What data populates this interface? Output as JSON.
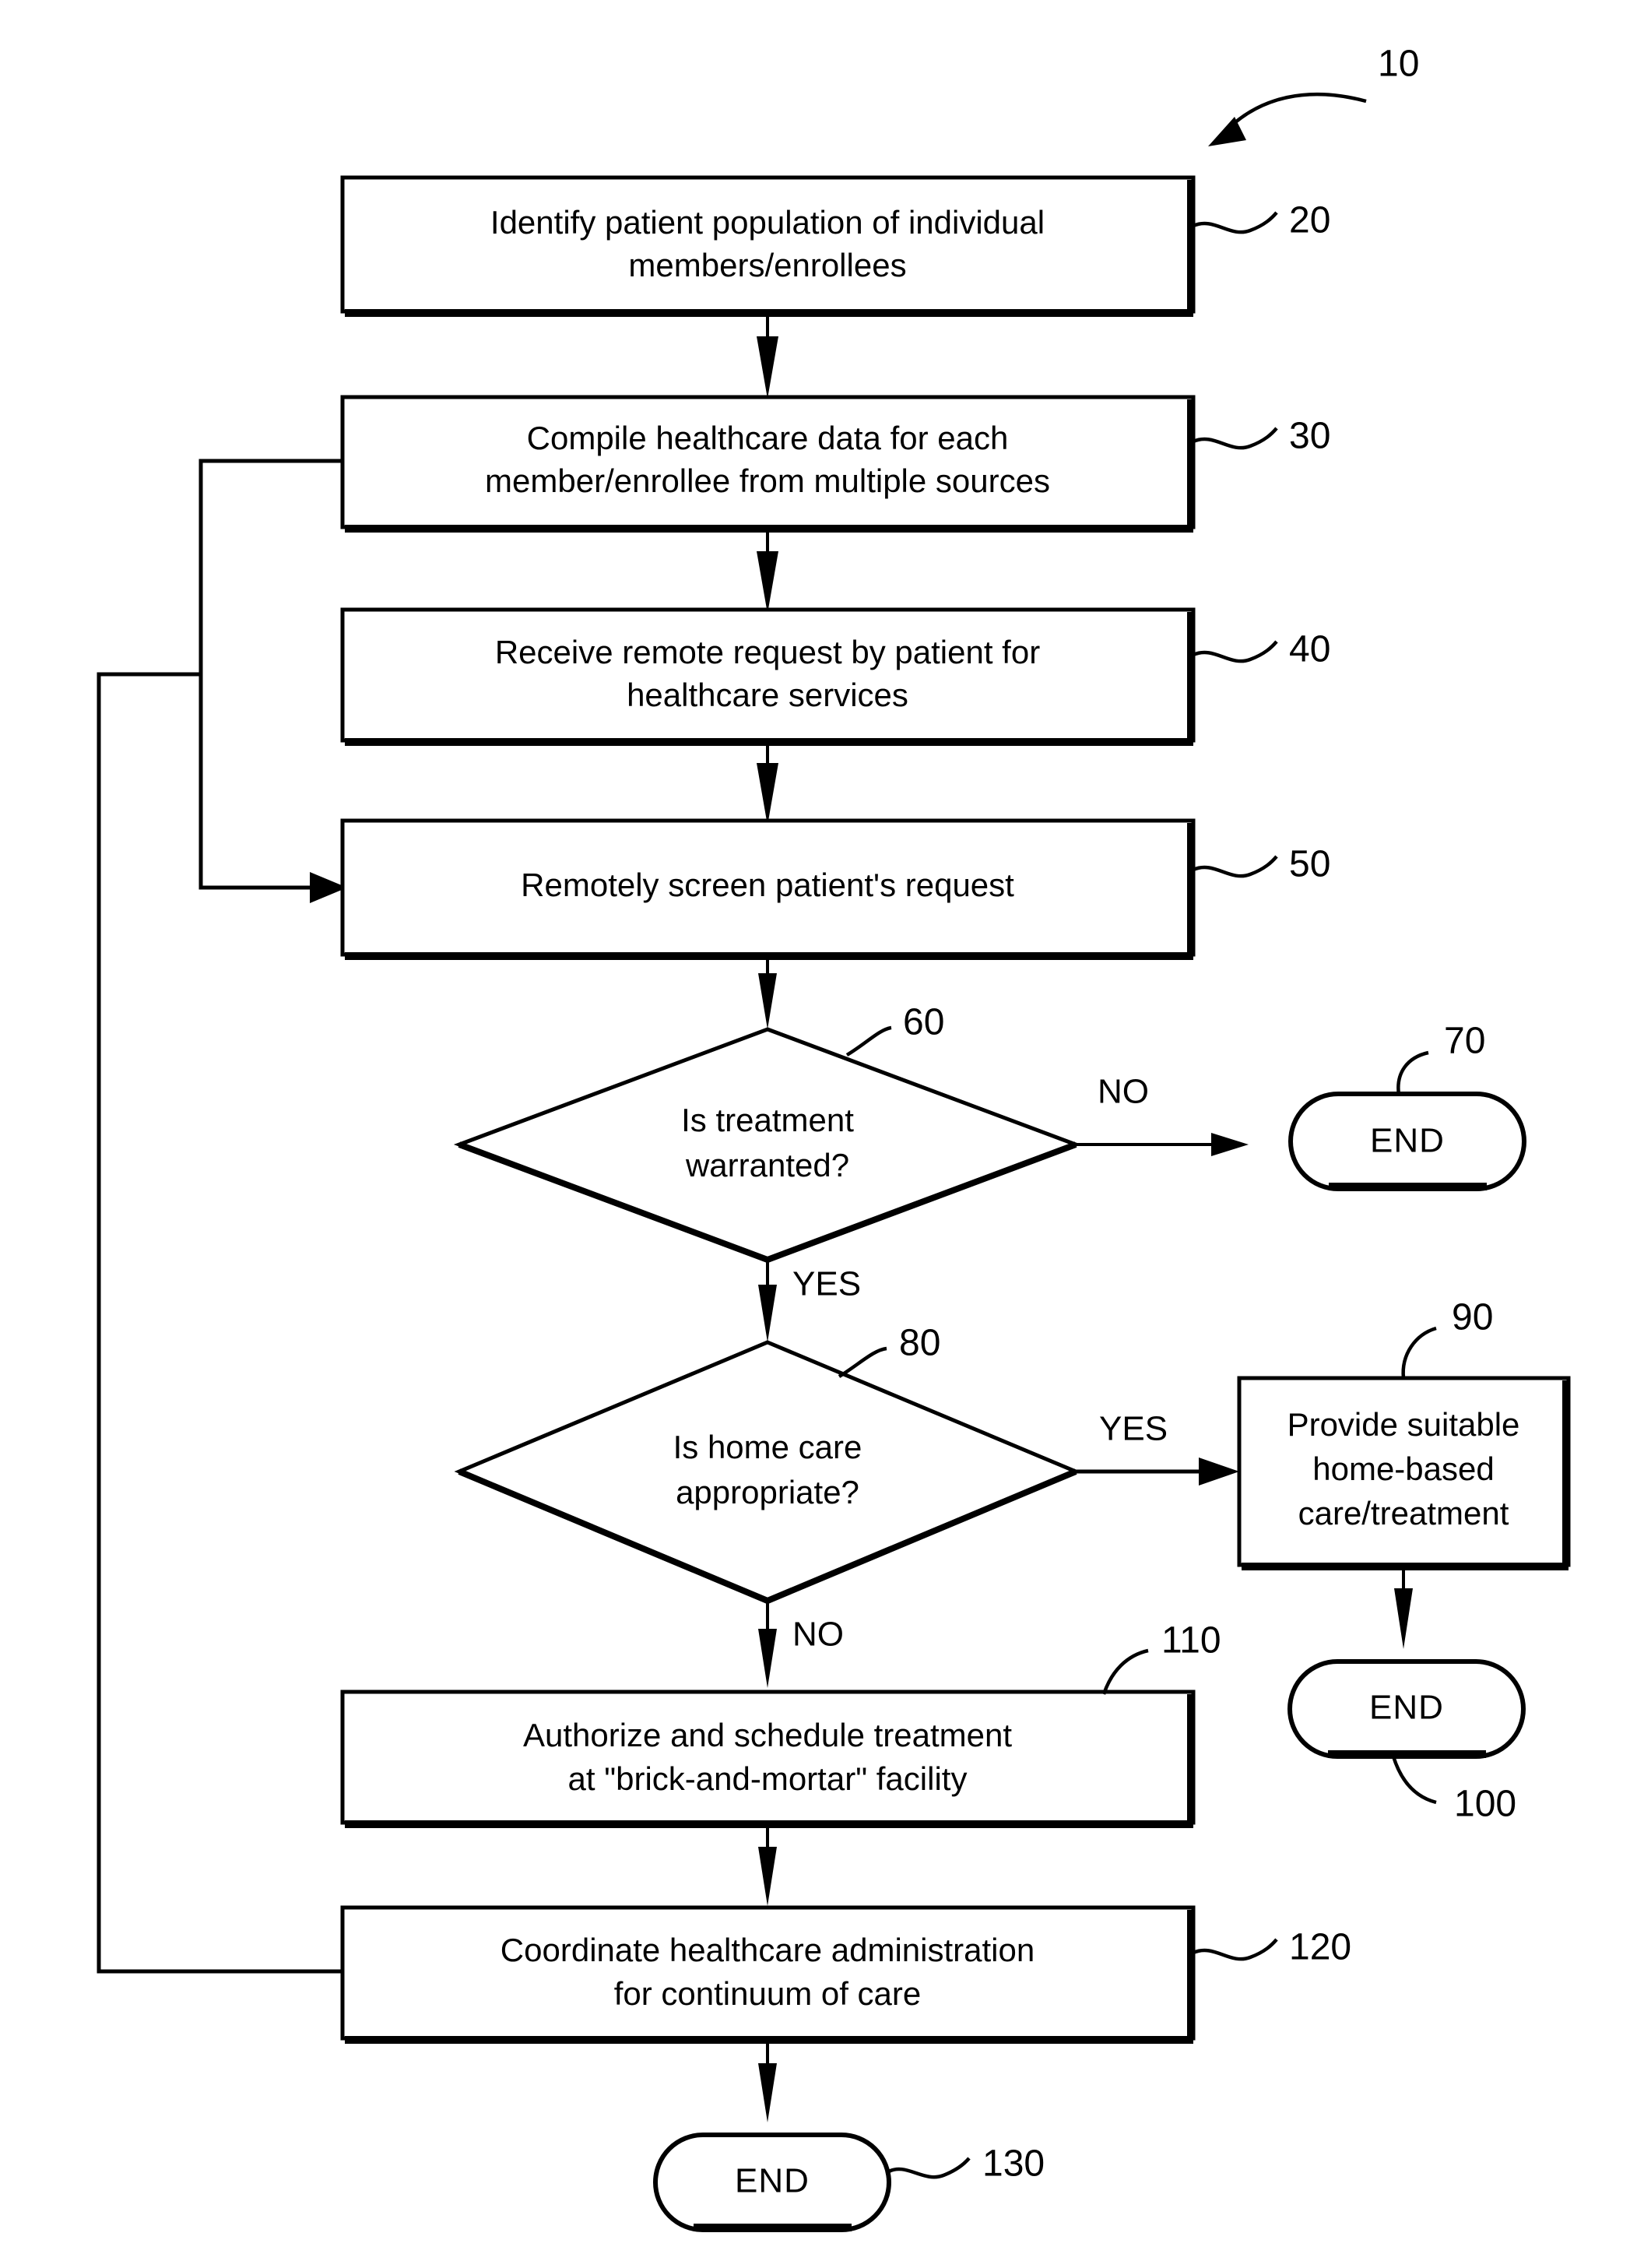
{
  "figure": {
    "label": "10",
    "type": "patent-flowchart",
    "background_color": "#ffffff",
    "line_color": "#000000"
  },
  "nodes": [
    {
      "id": "n20",
      "ref": "20",
      "shape": "process",
      "lines": [
        "Identify patient population of individual",
        "members/enrollees"
      ]
    },
    {
      "id": "n30",
      "ref": "30",
      "shape": "process",
      "lines": [
        "Compile healthcare data for each",
        "member/enrollee from multiple sources"
      ]
    },
    {
      "id": "n40",
      "ref": "40",
      "shape": "process",
      "lines": [
        "Receive remote request by patient for",
        "healthcare services"
      ]
    },
    {
      "id": "n50",
      "ref": "50",
      "shape": "process",
      "lines": [
        "Remotely screen patient's request"
      ]
    },
    {
      "id": "n60",
      "ref": "60",
      "shape": "decision",
      "lines": [
        "Is treatment",
        "warranted?"
      ]
    },
    {
      "id": "n70",
      "ref": "70",
      "shape": "terminator",
      "lines": [
        "END"
      ]
    },
    {
      "id": "n80",
      "ref": "80",
      "shape": "decision",
      "lines": [
        "Is home care",
        "appropriate?"
      ]
    },
    {
      "id": "n90",
      "ref": "90",
      "shape": "process",
      "lines": [
        "Provide suitable",
        "home-based",
        "care/treatment"
      ]
    },
    {
      "id": "n100",
      "ref": "100",
      "shape": "terminator",
      "lines": [
        "END"
      ]
    },
    {
      "id": "n110",
      "ref": "110",
      "shape": "process",
      "lines": [
        "Authorize and schedule treatment",
        "at \"brick-and-mortar\" facility"
      ]
    },
    {
      "id": "n120",
      "ref": "120",
      "shape": "process",
      "lines": [
        "Coordinate healthcare administration",
        "for continuum of care"
      ]
    },
    {
      "id": "n130",
      "ref": "130",
      "shape": "terminator",
      "lines": [
        "END"
      ]
    }
  ],
  "branch_labels": {
    "d60_no": "NO",
    "d60_yes": "YES",
    "d80_yes": "YES",
    "d80_no": "NO"
  }
}
